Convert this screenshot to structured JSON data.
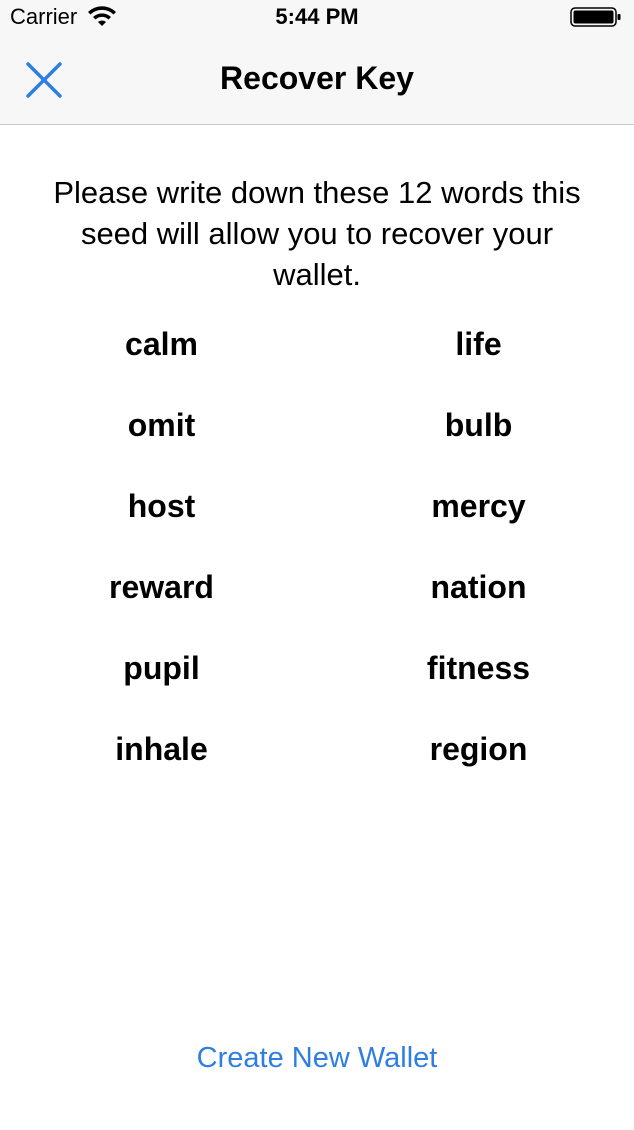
{
  "status_bar": {
    "carrier": "Carrier",
    "time": "5:44 PM"
  },
  "nav": {
    "title": "Recover Key",
    "close_icon": "close-icon",
    "accent_color": "#2f7fe2"
  },
  "instructions": "Please write down these 12 words this seed will allow you to recover your wallet.",
  "words": [
    "calm",
    "life",
    "omit",
    "bulb",
    "host",
    "mercy",
    "reward",
    "nation",
    "pupil",
    "fitness",
    "inhale",
    "region"
  ],
  "actions": {
    "create_wallet_label": "Create New Wallet"
  }
}
